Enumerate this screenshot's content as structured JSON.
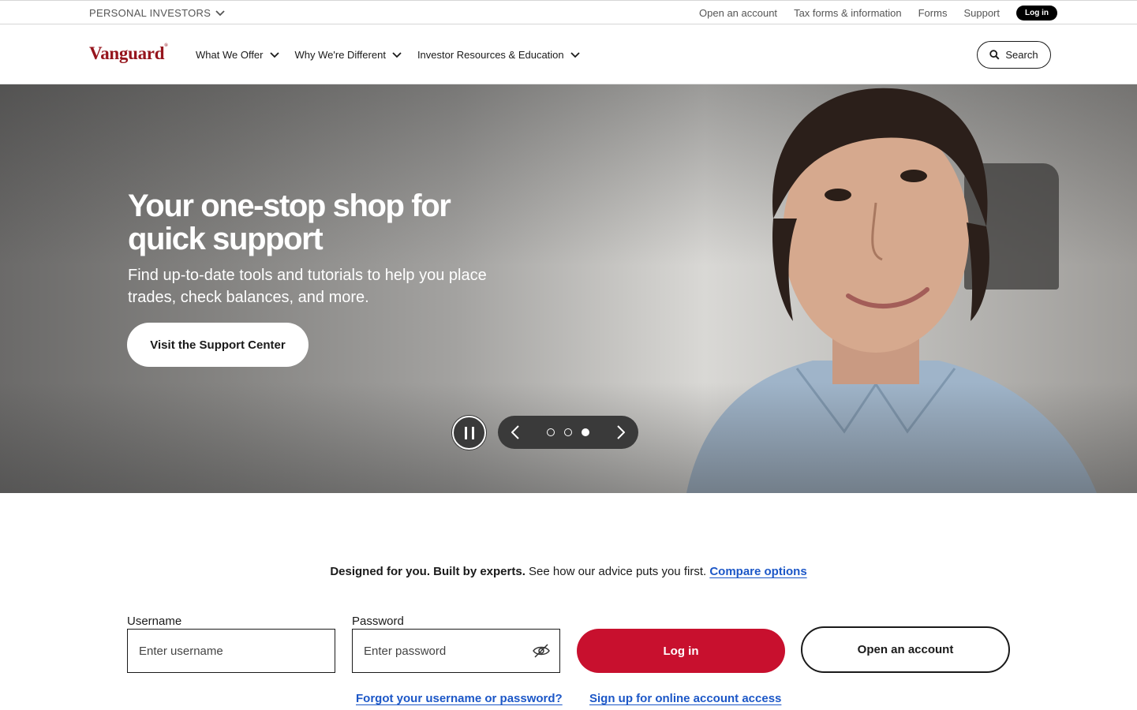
{
  "utility_bar": {
    "audience": "PERSONAL INVESTORS",
    "links": [
      "Open an account",
      "Tax forms & information",
      "Forms",
      "Support"
    ],
    "login": "Log in"
  },
  "nav": {
    "logo": "Vanguard",
    "items": [
      "What We Offer",
      "Why We're Different",
      "Investor Resources & Education"
    ],
    "search": "Search"
  },
  "hero": {
    "title": "Your one-stop shop for quick support",
    "subtitle": "Find up-to-date tools and tutorials to help you place trades, check balances, and more.",
    "cta": "Visit the Support Center",
    "carousel": {
      "slides": 3,
      "active": 3
    }
  },
  "advice": {
    "bold": "Designed for you. Built by experts.",
    "text": "See how our advice puts you first.",
    "link": "Compare options"
  },
  "login_form": {
    "username_label": "Username",
    "username_placeholder": "Enter username",
    "password_label": "Password",
    "password_placeholder": "Enter password",
    "login_button": "Log in",
    "open_account_button": "Open an account",
    "forgot_link": "Forgot your username or password?",
    "signup_link": "Sign up for online account access"
  },
  "colors": {
    "brand": "#96151d",
    "cta_red": "#c8102e",
    "link_blue": "#1c57c7"
  }
}
